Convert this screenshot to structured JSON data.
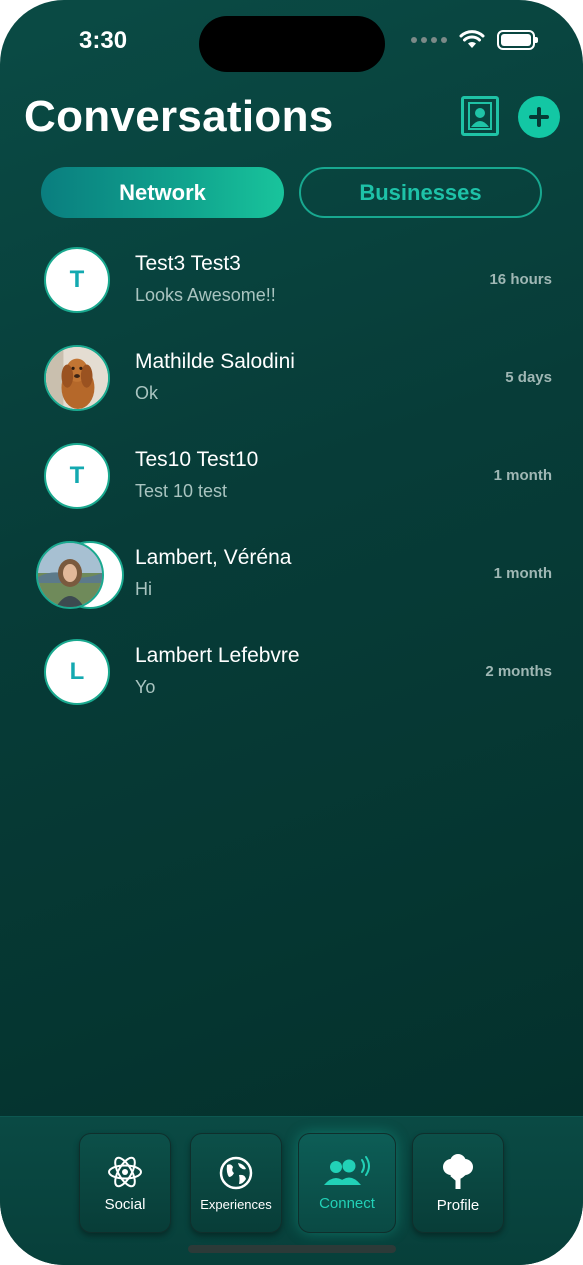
{
  "status_bar": {
    "time": "3:30"
  },
  "header": {
    "title": "Conversations",
    "contacts_icon": "contact-book-icon",
    "add_icon": "plus-icon"
  },
  "tabs": [
    {
      "label": "Network",
      "selected": true
    },
    {
      "label": "Businesses",
      "selected": false
    }
  ],
  "conversations": [
    {
      "initial": "T",
      "name": "Test3 Test3",
      "last_message": "Looks Awesome!!",
      "time": "16 hours",
      "avatar_type": "initial"
    },
    {
      "initial": "",
      "name": "Mathilde Salodini",
      "last_message": "Ok",
      "time": "5 days",
      "avatar_type": "photo-dog"
    },
    {
      "initial": "T",
      "name": "Tes10 Test10",
      "last_message": "Test 10 test",
      "time": "1 month",
      "avatar_type": "initial"
    },
    {
      "initial": "",
      "name": "Lambert, Véréna",
      "last_message": "Hi",
      "time": "1 month",
      "avatar_type": "group-photo"
    },
    {
      "initial": "L",
      "name": "Lambert Lefebvre",
      "last_message": "Yo",
      "time": "2 months",
      "avatar_type": "initial"
    }
  ],
  "nav": [
    {
      "label": "Social",
      "icon": "atom-icon"
    },
    {
      "label": "Experiences",
      "icon": "globe-icon"
    },
    {
      "label": "Connect",
      "icon": "people-signal-icon",
      "selected": true
    },
    {
      "label": "Profile",
      "icon": "tree-icon"
    }
  ],
  "colors": {
    "accent": "#13c7a4",
    "background": "#073c38",
    "avatar_text": "#13a9b0"
  }
}
